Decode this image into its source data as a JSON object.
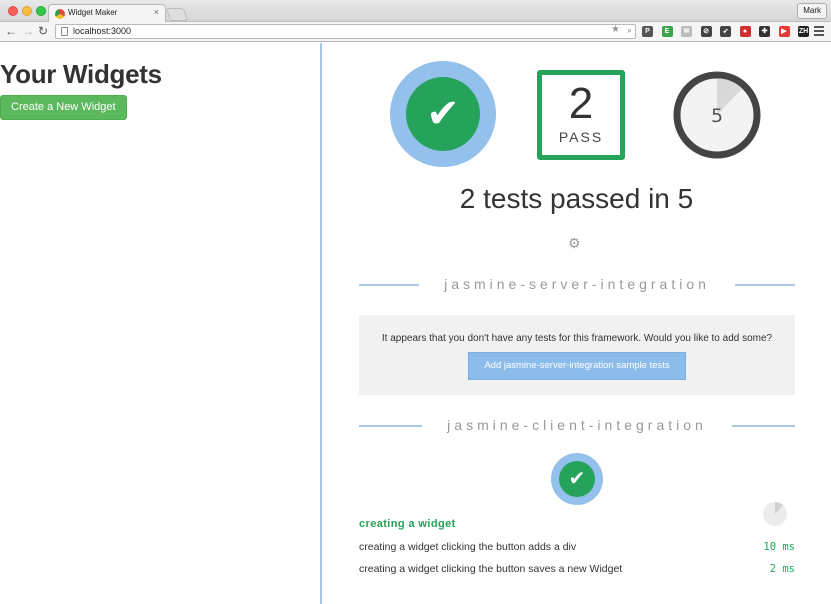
{
  "browser": {
    "tab_title": "Widget Maker",
    "tab_close": "×",
    "user": "Mark",
    "url": "localhost:3000",
    "icons": {
      "back": "←",
      "forward": "→",
      "reload": "↻",
      "star": "★",
      "zoom": "🔍"
    },
    "extensions": [
      {
        "name": "pocket-icon",
        "color": "#555555",
        "glyph": "P"
      },
      {
        "name": "evernote-icon",
        "color": "#3aa54a",
        "glyph": "E"
      },
      {
        "name": "mail-icon",
        "color": "#bbbbbb",
        "glyph": "✉"
      },
      {
        "name": "block-icon",
        "color": "#444444",
        "glyph": "⊘"
      },
      {
        "name": "rocket-icon",
        "color": "#444444",
        "glyph": "➶"
      },
      {
        "name": "lastpass-icon",
        "color": "#d32f2f",
        "glyph": "●"
      },
      {
        "name": "puzzle-icon",
        "color": "#333333",
        "glyph": "✚"
      },
      {
        "name": "youtube-icon",
        "color": "#e53935",
        "glyph": "▶"
      },
      {
        "name": "zh-icon",
        "color": "#222222",
        "glyph": "ZH"
      }
    ]
  },
  "app": {
    "title": "Your Widgets",
    "create_button": "Create a New Widget"
  },
  "velocity": {
    "check_glyph": "✔",
    "pass_count": "2",
    "pass_label": "PASS",
    "timer_value": "5",
    "timer_fraction": 0.12,
    "summary": "2 tests passed in 5",
    "gear_glyph": "⚙",
    "colors": {
      "pass_green": "#25a35a",
      "ring_blue": "#94c0ec",
      "divider_blue": "#a9c7ea"
    }
  },
  "server_section": {
    "title": "jasmine-server-integration",
    "notice": "It appears that you don't have any tests for this framework. Would you like to add some?",
    "button": "Add jasmine-server-integration sample tests"
  },
  "client_section": {
    "title": "jasmine-client-integration",
    "mini_timer_fraction": 0.12,
    "suite": "creating a widget",
    "specs": [
      {
        "description": "creating a widget clicking the button adds a div",
        "time": "10 ms"
      },
      {
        "description": "creating a widget clicking the button saves a new Widget",
        "time": "2 ms"
      }
    ]
  }
}
